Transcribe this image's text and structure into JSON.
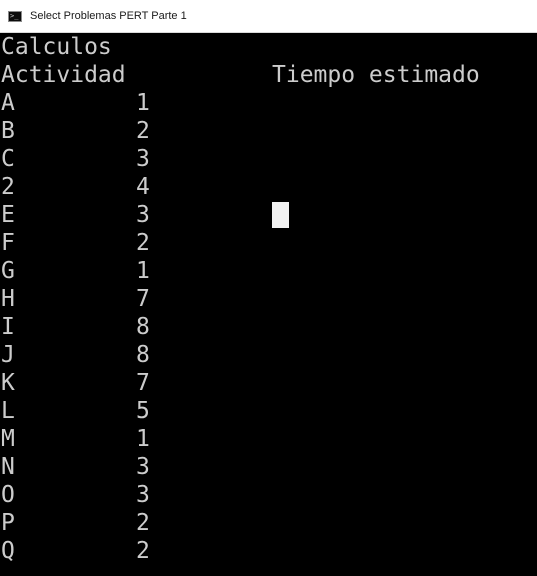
{
  "window": {
    "title": "Select Problemas PERT Parte 1",
    "icon": "console-icon"
  },
  "console": {
    "heading": "Calculos",
    "col_activity": "Actividad",
    "col_time": "Tiempo estimado",
    "rows": [
      {
        "activity": "A",
        "time": "1"
      },
      {
        "activity": "B",
        "time": "2"
      },
      {
        "activity": "C",
        "time": "3"
      },
      {
        "activity": "2",
        "time": "4"
      },
      {
        "activity": "E",
        "time": "3"
      },
      {
        "activity": "F",
        "time": "2"
      },
      {
        "activity": "G",
        "time": "1"
      },
      {
        "activity": "H",
        "time": "7"
      },
      {
        "activity": "I",
        "time": "8"
      },
      {
        "activity": "J",
        "time": "8"
      },
      {
        "activity": "K",
        "time": "7"
      },
      {
        "activity": "L",
        "time": "5"
      },
      {
        "activity": "M",
        "time": "1"
      },
      {
        "activity": "N",
        "time": "3"
      },
      {
        "activity": "O",
        "time": "3"
      },
      {
        "activity": "P",
        "time": "2"
      },
      {
        "activity": "Q",
        "time": "2"
      }
    ]
  },
  "colors": {
    "background": "#000000",
    "text": "#cccccc",
    "cursor": "#f2f2f2",
    "titlebar": "#ffffff"
  }
}
